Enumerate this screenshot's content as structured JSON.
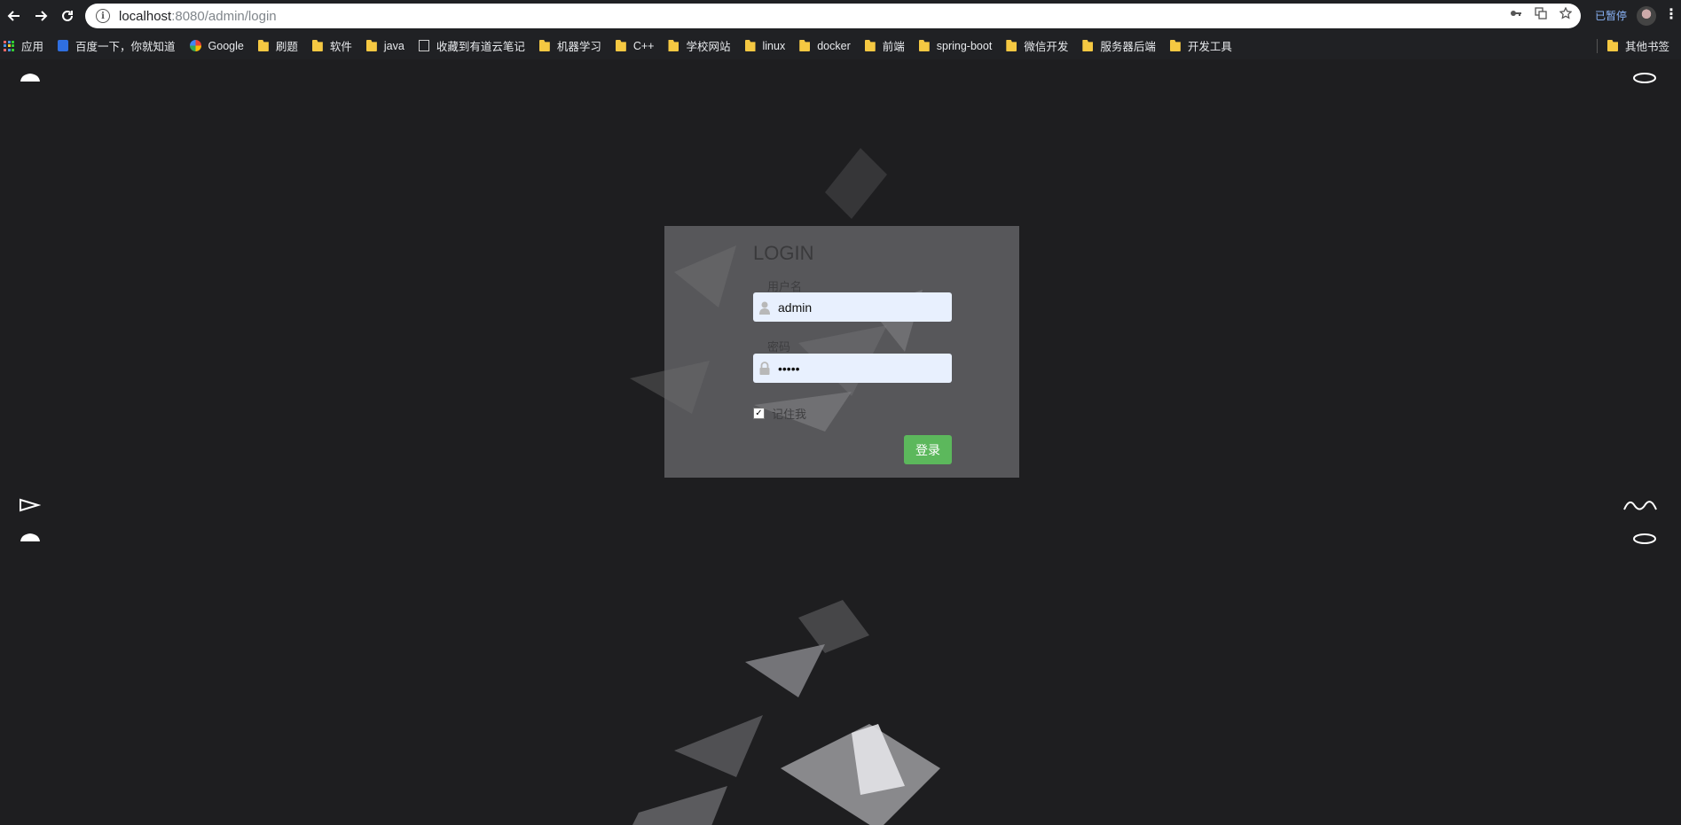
{
  "browser": {
    "url_host": "localhost",
    "url_path": ":8080/admin/login",
    "paused_label": "已暂停",
    "bookmarks": [
      {
        "label": "应用",
        "icon": "apps-icon"
      },
      {
        "label": "百度一下，你就知道",
        "icon": "baidu-icon"
      },
      {
        "label": "Google",
        "icon": "google-icon"
      },
      {
        "label": "刷题",
        "icon": "folder-icon"
      },
      {
        "label": "软件",
        "icon": "folder-icon"
      },
      {
        "label": "java",
        "icon": "folder-icon"
      },
      {
        "label": "收藏到有道云笔记",
        "icon": "page-icon"
      },
      {
        "label": "机器学习",
        "icon": "folder-icon"
      },
      {
        "label": "C++",
        "icon": "folder-icon"
      },
      {
        "label": "学校网站",
        "icon": "folder-icon"
      },
      {
        "label": "linux",
        "icon": "folder-icon"
      },
      {
        "label": "docker",
        "icon": "folder-icon"
      },
      {
        "label": "前端",
        "icon": "folder-icon"
      },
      {
        "label": "spring-boot",
        "icon": "folder-icon"
      },
      {
        "label": "微信开发",
        "icon": "folder-icon"
      },
      {
        "label": "服务器后端",
        "icon": "folder-icon"
      },
      {
        "label": "开发工具",
        "icon": "folder-icon"
      }
    ],
    "other_bookmarks": "其他书签"
  },
  "login": {
    "title": "LOGIN",
    "username_label": "用户名",
    "username_value": "admin",
    "password_label": "密码",
    "password_value": "•••••",
    "remember_label": "记住我",
    "remember_checked": true,
    "submit_label": "登录",
    "submit_color": "#5cb85c"
  }
}
